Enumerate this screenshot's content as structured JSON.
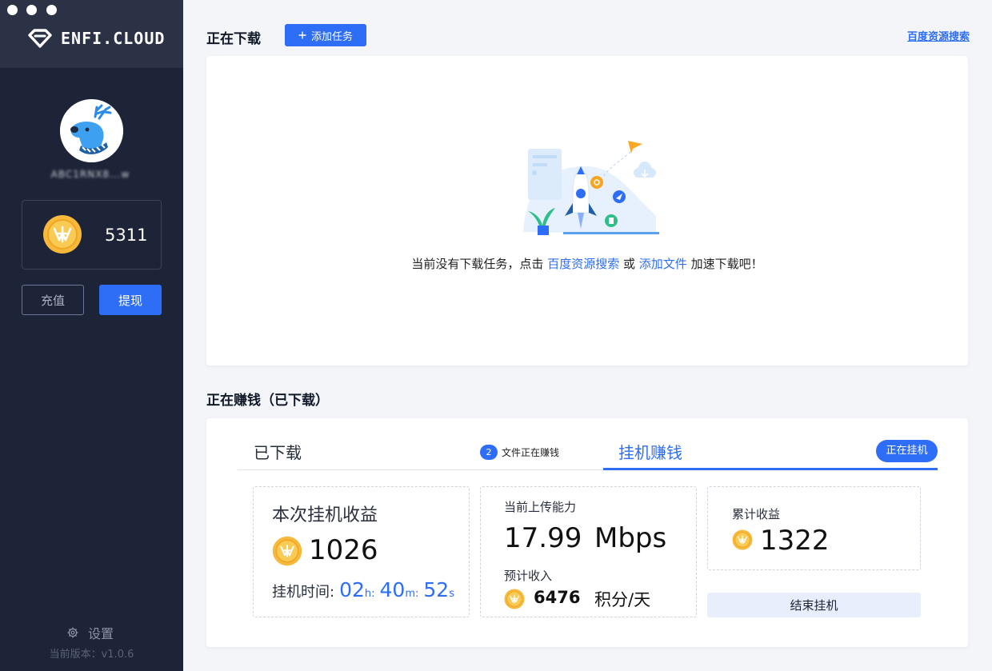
{
  "app": {
    "logo_text": "ENFI.CLOUD",
    "username": "ABC1RNX8...w"
  },
  "sidebar": {
    "balance": "5311",
    "recharge_label": "充值",
    "withdraw_label": "提现",
    "settings_label": "设置",
    "version": "当前版本：v1.0.6"
  },
  "downloading": {
    "title": "正在下载",
    "add_task_label": "添加任务",
    "baidu_search_link": "百度资源搜索",
    "empty_prefix": "当前没有下载任务，点击",
    "empty_link1": "百度资源搜索",
    "empty_or": "或",
    "empty_link2": "添加文件",
    "empty_suffix": "加速下载吧！"
  },
  "earning": {
    "title": "正在赚钱（已下载）",
    "tab_downloaded": "已下载",
    "files_count": "2",
    "files_text": "文件正在赚钱",
    "tab_mining": "挂机赚钱",
    "status": "正在挂机",
    "session_title": "本次挂机收益",
    "session_value": "1026",
    "time_label": "挂机时间:",
    "hours": "02",
    "hours_unit": "h:",
    "minutes": "40",
    "minutes_unit": "m:",
    "seconds": "52",
    "seconds_unit": "s",
    "upload_label": "当前上传能力",
    "upload_value": "17.99",
    "upload_unit": "Mbps",
    "estimate_label": "预计收入",
    "estimate_value": "6476",
    "estimate_unit": "积分/天",
    "total_label": "累计收益",
    "total_value": "1322",
    "end_button": "结束挂机"
  },
  "colors": {
    "accent": "#2e6df6",
    "sidebar_bg": "#1e2438",
    "coin": "#f6b93b"
  }
}
